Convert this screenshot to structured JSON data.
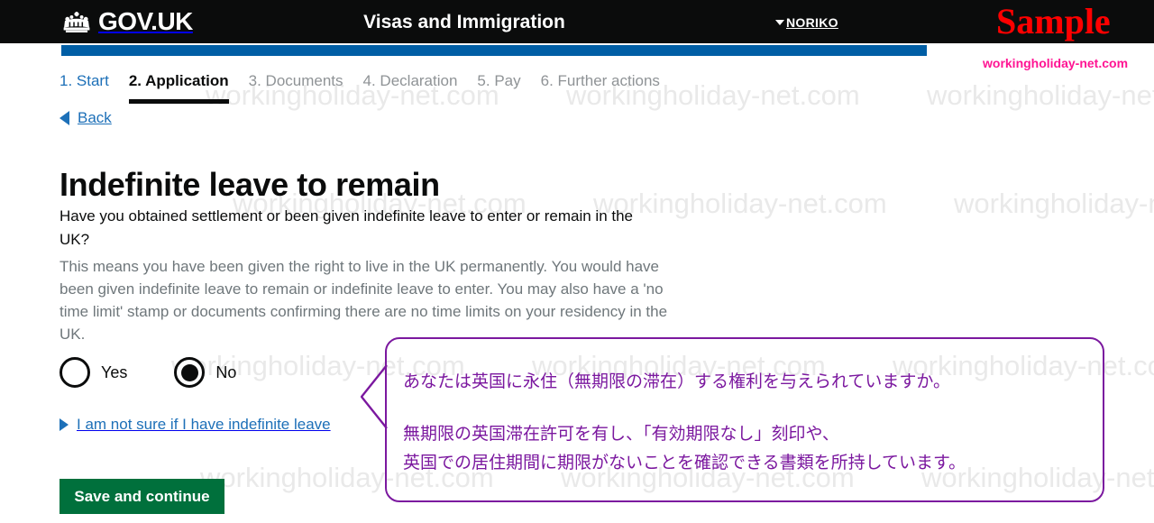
{
  "header": {
    "brand": "GOV.UK",
    "crown_icon": "crown-icon",
    "title": "Visas and Immigration",
    "account_name": "NORIKO",
    "account_caret_icon": "chevron-down-icon",
    "sample_stamp": "Sample",
    "site_url": "workingholiday-net.com",
    "background_color": "#0b0c0c",
    "sample_color": "#ff0000",
    "site_url_color": "#ff1493"
  },
  "progress": {
    "color": "#005ea5"
  },
  "steps": [
    {
      "label": "1. Start",
      "state": "link"
    },
    {
      "label": "2. Application",
      "state": "current"
    },
    {
      "label": "3. Documents",
      "state": "muted"
    },
    {
      "label": "4. Declaration",
      "state": "muted"
    },
    {
      "label": "5. Pay",
      "state": "muted"
    },
    {
      "label": "6. Further actions",
      "state": "muted"
    }
  ],
  "back": {
    "label": "Back",
    "arrow_icon": "arrow-left-icon",
    "color": "#1d70b8"
  },
  "main": {
    "page_title": "Indefinite leave to remain",
    "question": "Have you obtained settlement or been given indefinite leave to enter or remain in the UK?",
    "hint": "This means you have been given the right to live in the UK permanently. You would have been given indefinite leave to remain or indefinite leave to enter. You may also have a 'no time limit' stamp or documents confirming there are no time limits on your residency in the UK.",
    "radios": [
      {
        "label": "Yes",
        "checked": false
      },
      {
        "label": "No",
        "checked": true
      }
    ],
    "details_label": "I am not sure if I have indefinite leave",
    "details_arrow_icon": "triangle-right-icon",
    "save_label": "Save and continue",
    "save_color": "#00703c"
  },
  "callout": {
    "border_color": "#7b189f",
    "text_color": "#7b189f",
    "line1": "あなたは英国に永住（無期限の滞在）する権利を与えられていますか。",
    "line2": "無期限の英国滞在許可を有し、「有効期限なし」刻印や、",
    "line3": "英国での居住期間に期限がないことを確認できる書類を所持しています。"
  },
  "watermark": {
    "text": "workingholiday-net.com",
    "color": "#e9e9e9"
  }
}
